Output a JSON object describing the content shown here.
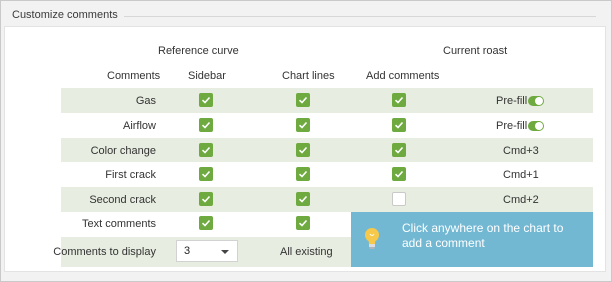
{
  "section": {
    "title": "Customize comments"
  },
  "groups": {
    "reference": "Reference curve",
    "current": "Current roast"
  },
  "columns": {
    "comments": "Comments",
    "sidebar": "Sidebar",
    "chart_lines": "Chart lines",
    "add_comments": "Add comments"
  },
  "rows": [
    {
      "label": "Gas",
      "sidebar": true,
      "chart_lines": true,
      "add_comments": true,
      "shortcut": "Pre-fill",
      "toggle": true
    },
    {
      "label": "Airflow",
      "sidebar": true,
      "chart_lines": true,
      "add_comments": true,
      "shortcut": "Pre-fill",
      "toggle": true
    },
    {
      "label": "Color change",
      "sidebar": true,
      "chart_lines": true,
      "add_comments": true,
      "shortcut": "Cmd+3",
      "toggle": false
    },
    {
      "label": "First crack",
      "sidebar": true,
      "chart_lines": true,
      "add_comments": true,
      "shortcut": "Cmd+1",
      "toggle": false
    },
    {
      "label": "Second crack",
      "sidebar": true,
      "chart_lines": true,
      "add_comments": false,
      "shortcut": "Cmd+2",
      "toggle": false
    },
    {
      "label": "Text comments",
      "sidebar": true,
      "chart_lines": true
    }
  ],
  "display": {
    "label": "Comments to display",
    "value": "3",
    "all_existing": "All existing"
  },
  "callout": {
    "text": "Click anywhere on the chart to add a comment",
    "icon": "lightbulb-icon"
  },
  "colors": {
    "accent_green": "#6eaa3f",
    "row_tint": "#e7ede1",
    "callout_bg": "#73b8d3"
  }
}
